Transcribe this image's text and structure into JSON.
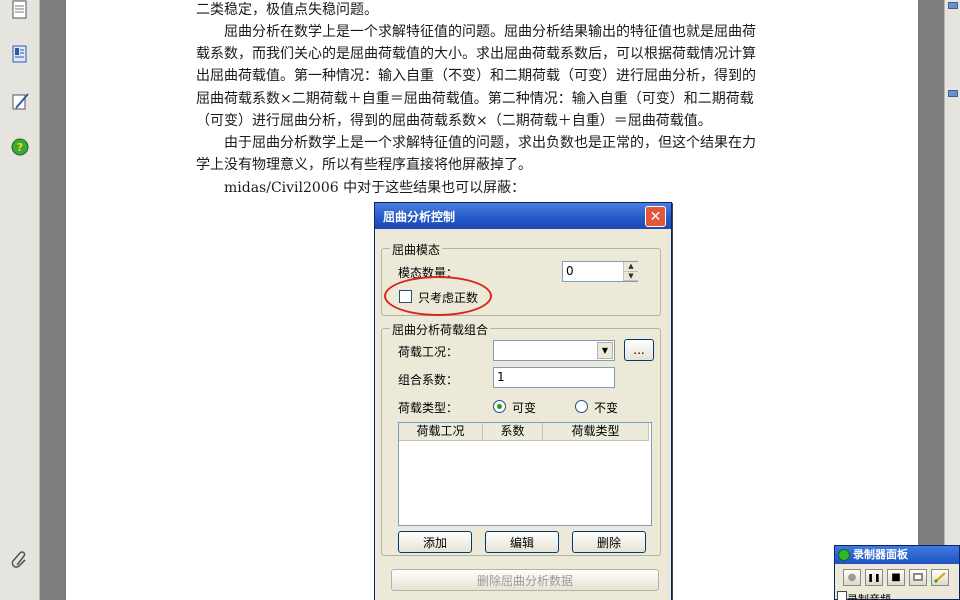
{
  "sidebar": {
    "icons": [
      "page-icon",
      "bookmark-icon",
      "sign-icon",
      "help-icon",
      "attachment-icon"
    ]
  },
  "doc": {
    "lines": [
      "二类稳定，极值点失稳问题。",
      "屈曲分析在数学上是一个求解特征值的问题。屈曲分析结果输出的特征值也就是屈曲荷",
      "载系数，而我们关心的是屈曲荷载值的大小。求出屈曲荷载系数后，可以根据荷载情况计算",
      "出屈曲荷载值。第一种情况：输入自重（不变）和二期荷载（可变）进行屈曲分析，得到的",
      "屈曲荷载系数×二期荷载＋自重＝屈曲荷载值。第二种情况：输入自重（可变）和二期荷载",
      "（可变）进行屈曲分析，得到的屈曲荷载系数×（二期荷载＋自重）＝屈曲荷载值。",
      "由于屈曲分析数学上是一个求解特征值的问题，求出负数也是正常的，但这个结果在力",
      "学上没有物理意义，所以有些程序直接将他屏蔽掉了。",
      "midas/Civil2006 中对于这些结果也可以屏蔽："
    ]
  },
  "dialog": {
    "title": "屈曲分析控制",
    "close_symbol": "✕",
    "mode_group": {
      "legend": "屈曲模态",
      "count_label": "模态数量：",
      "count_value": "0",
      "spin_up": "▲",
      "spin_down": "▼",
      "positive_only_label": "只考虑正数",
      "positive_only_checked": false
    },
    "load_group": {
      "legend": "屈曲分析荷载组合",
      "load_case_label": "荷载工况：",
      "load_case_value": "",
      "dropdown_symbol": "▼",
      "browse_label": "...",
      "factor_label": "组合系数：",
      "factor_value": "1",
      "type_label": "荷载类型：",
      "type_variable": "可变",
      "type_constant": "不变",
      "selected_type": "可变",
      "columns": [
        "荷载工况",
        "系数",
        "荷载类型"
      ],
      "rows": [],
      "add_label": "添加",
      "edit_label": "编辑",
      "delete_label": "删除"
    },
    "delete_data_label": "删除屈曲分析数据"
  },
  "recorder": {
    "title": "录制器面板",
    "buttons": [
      "●",
      "❚❚",
      "■",
      "",
      ""
    ],
    "option_label": "录制音频"
  },
  "colors": {
    "dialog_title_bar": "#2458c9",
    "highlight_circle": "#d9261c",
    "accent_green": "#21a121"
  }
}
